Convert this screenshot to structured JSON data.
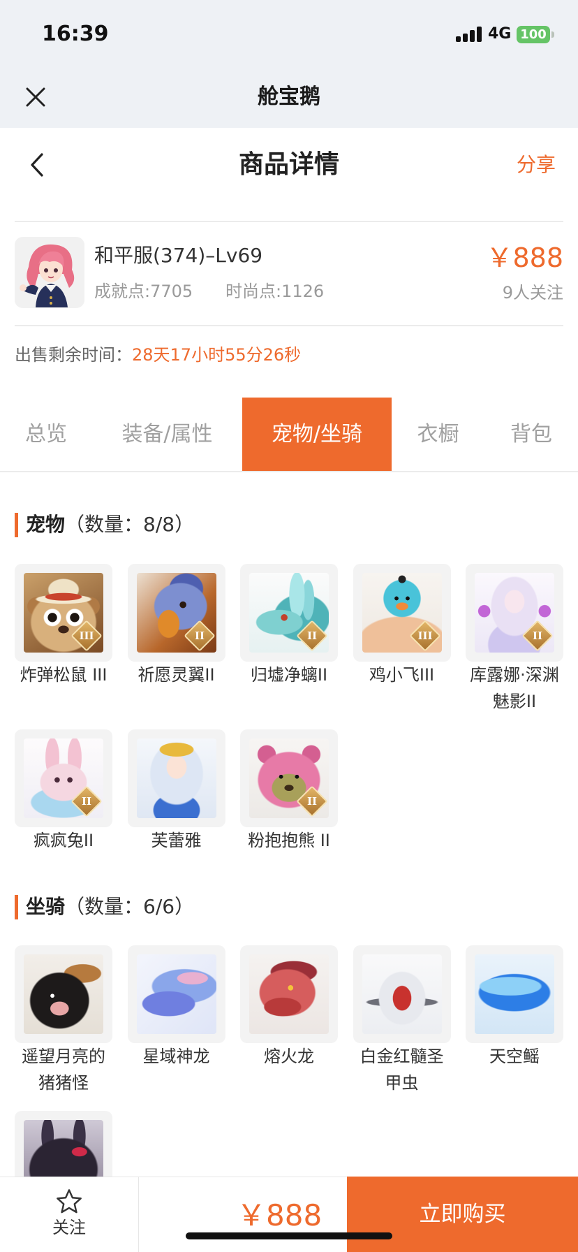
{
  "status_bar": {
    "time": "16:39",
    "network": "4G",
    "battery": "100",
    "signal_icon": "cellular-signal-icon"
  },
  "app_bar": {
    "title": "舱宝鹅",
    "close_icon": "close-icon"
  },
  "header": {
    "back_icon": "chevron-left-icon",
    "title": "商品详情",
    "share": "分享"
  },
  "product": {
    "name": "和平服(374)–Lv69",
    "achievement": "成就点:7705",
    "fashion": "时尚点:1126",
    "price": "￥888",
    "followers": "9人关注"
  },
  "sale_timer": {
    "label": "出售剩余时间：",
    "remaining": "28天17小时55分26秒"
  },
  "tabs": [
    {
      "label": "总览",
      "active": false
    },
    {
      "label": "装备/属性",
      "active": false
    },
    {
      "label": "宠物/坐骑",
      "active": true
    },
    {
      "label": "衣橱",
      "active": false
    },
    {
      "label": "背包",
      "active": false
    }
  ],
  "pets": {
    "title": "宠物",
    "count": "（数量：8/8）",
    "items": [
      {
        "name": "炸弹松鼠 III",
        "badge": "III"
      },
      {
        "name": "祈愿灵翼II",
        "badge": "II"
      },
      {
        "name": "归墟净螭II",
        "badge": "II"
      },
      {
        "name": "鸡小飞III",
        "badge": "III"
      },
      {
        "name": "库露娜·深渊魅影II",
        "badge": "II"
      },
      {
        "name": "疯疯兔II",
        "badge": "II"
      },
      {
        "name": "芙蕾雅"
      },
      {
        "name": "粉抱抱熊 II",
        "badge": "II"
      }
    ]
  },
  "mounts": {
    "title": "坐骑",
    "count": "（数量：6/6）",
    "items": [
      {
        "name": "遥望月亮的猪猪怪"
      },
      {
        "name": "星域神龙"
      },
      {
        "name": "熔火龙"
      },
      {
        "name": "白金红髓圣甲虫"
      },
      {
        "name": "天空鳐"
      },
      {}
    ]
  },
  "bottom_bar": {
    "follow_icon": "star-icon",
    "follow": "关注",
    "price": "￥888",
    "buy": "立即购买"
  },
  "colors": {
    "accent": "#ee6a2d",
    "battery": "#65c466",
    "app_bar_bg": "#eef1f5"
  }
}
